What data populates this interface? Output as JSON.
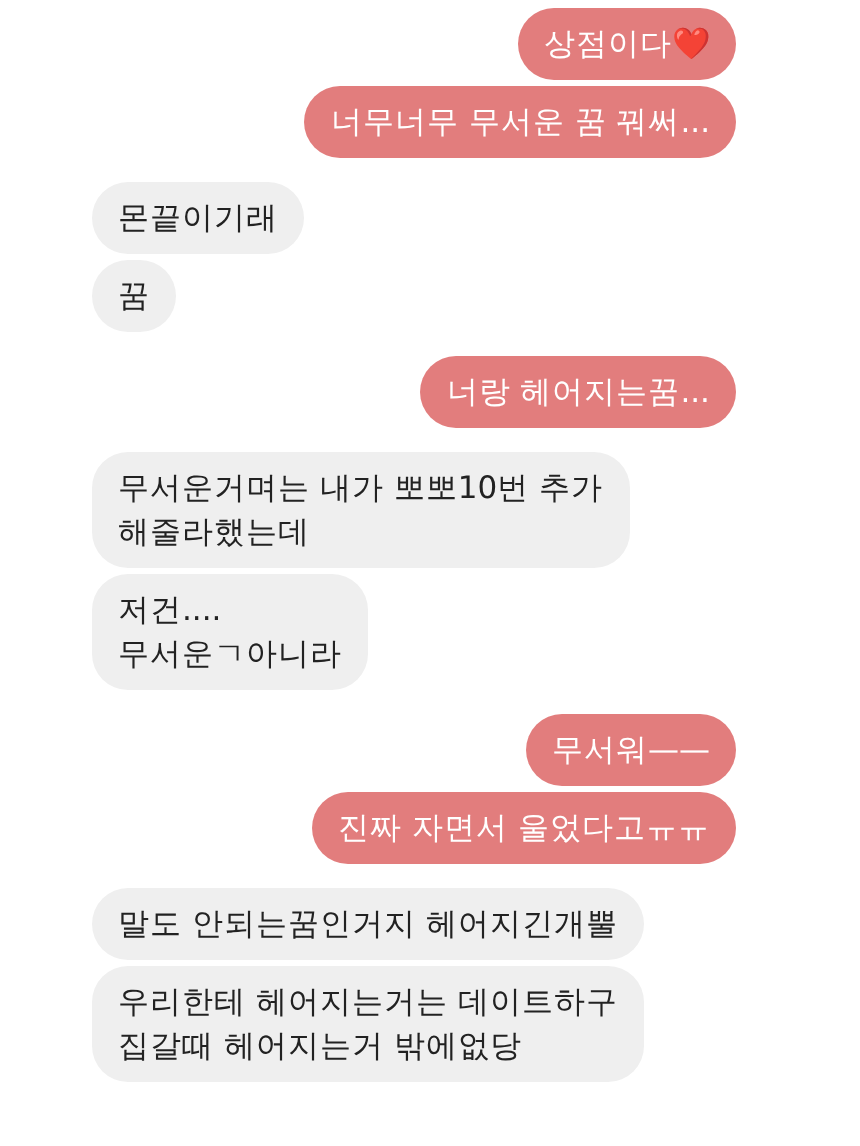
{
  "messages": [
    {
      "kind": "sent",
      "text": "상점이다❤️"
    },
    {
      "kind": "sent",
      "text": "너무너무 무서운 꿈 꿔써..."
    },
    {
      "kind": "received",
      "text": "몬끝이기래"
    },
    {
      "kind": "received",
      "text": "꿈"
    },
    {
      "kind": "sent",
      "text": "너랑 헤어지는꿈..."
    },
    {
      "kind": "received",
      "text": "무서운거며는 내가 뽀뽀10번 추가\n해줄라했는데"
    },
    {
      "kind": "received",
      "text": "저건....\n무서운ㄱ아니라"
    },
    {
      "kind": "sent",
      "text": "무서워——"
    },
    {
      "kind": "sent",
      "text": "진짜 자면서 울었다고ㅠㅠ"
    },
    {
      "kind": "received",
      "text": "말도 안되는꿈인거지 헤어지긴개뿔"
    },
    {
      "kind": "received",
      "text": "우리한테 헤어지는거는 데이트하구\n집갈때 헤어지는거 밖에없당"
    }
  ]
}
